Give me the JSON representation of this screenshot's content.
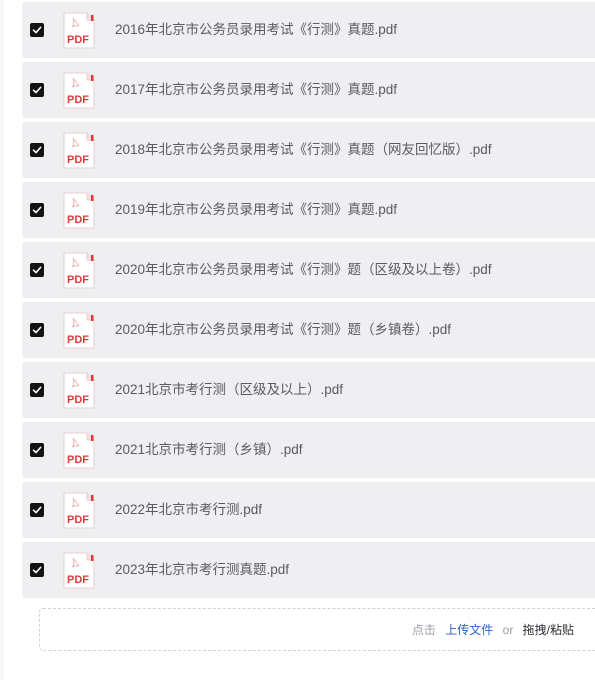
{
  "files": [
    {
      "name": "2016年北京市公务员录用考试《行测》真题.pdf",
      "checked": true
    },
    {
      "name": "2017年北京市公务员录用考试《行测》真题.pdf",
      "checked": true
    },
    {
      "name": "2018年北京市公务员录用考试《行测》真题（网友回忆版）.pdf",
      "checked": true
    },
    {
      "name": "2019年北京市公务员录用考试《行测》真题.pdf",
      "checked": true
    },
    {
      "name": "2020年北京市公务员录用考试《行测》题（区级及以上卷）.pdf",
      "checked": true
    },
    {
      "name": "2020年北京市公务员录用考试《行测》题（乡镇卷）.pdf",
      "checked": true
    },
    {
      "name": "2021北京市考行测（区级及以上）.pdf",
      "checked": true
    },
    {
      "name": "2021北京市考行测（乡镇）.pdf",
      "checked": true
    },
    {
      "name": "2022年北京市考行测.pdf",
      "checked": true
    },
    {
      "name": "2023年北京市考行测真题.pdf",
      "checked": true
    }
  ],
  "icons": {
    "checkbox": "check-icon",
    "file": "pdf-file-icon",
    "pdf_label": "PDF"
  },
  "upload": {
    "prefix": "点击",
    "link_label": "上传文件",
    "or_label": "or",
    "drag_label": "拖拽/粘贴"
  },
  "colors": {
    "row_bg": "#efeff2",
    "checkbox_bg": "#121212",
    "pdf_red": "#d93a3a",
    "link": "#2a62c9"
  }
}
